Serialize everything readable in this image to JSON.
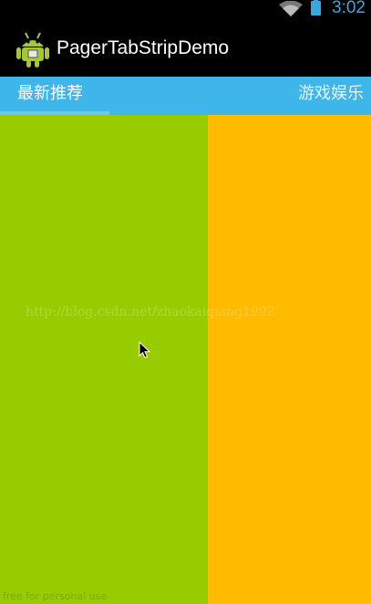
{
  "status_bar": {
    "time": "3:02",
    "wifi_icon": "wifi-icon",
    "battery_icon": "battery-icon",
    "accent": "#3aa8dc"
  },
  "action_bar": {
    "title": "PagerTabStripDemo",
    "icon": "android-robot-icon"
  },
  "tab_strip": {
    "background": "#3fb6e9",
    "tabs": [
      {
        "label": "最新推荐",
        "selected": true
      },
      {
        "label": "游戏娱乐",
        "selected": false
      }
    ]
  },
  "pages": [
    {
      "name": "green-page",
      "color": "#99cc00"
    },
    {
      "name": "orange-page",
      "color": "#ffbb00"
    }
  ],
  "watermark": "http://blog.csdn.net/zhaokaiqiang1992",
  "footer_note": "free for personal use",
  "cursor_icon": "mouse-pointer-icon"
}
